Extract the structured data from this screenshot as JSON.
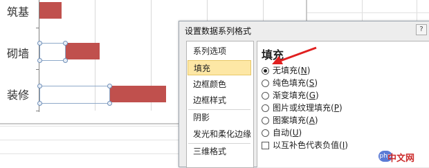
{
  "chart": {
    "categories": [
      "筑基",
      "砌墙",
      "装修"
    ]
  },
  "chart_data": {
    "type": "bar",
    "categories": [
      "筑基",
      "砌墙",
      "装修"
    ],
    "series": [
      {
        "values": [
          0,
          2,
          5
        ]
      },
      {
        "values": [
          2,
          2,
          4
        ]
      }
    ]
  },
  "dialog": {
    "title": "设置数据系列格式",
    "help": "?",
    "nav": [
      {
        "label": "系列选项",
        "active": false
      },
      {
        "label": "填充",
        "active": true
      },
      {
        "label": "边框颜色",
        "active": false
      },
      {
        "label": "边框样式",
        "active": false
      },
      {
        "label": "阴影",
        "active": false
      },
      {
        "label": "发光和柔化边缘",
        "active": false
      },
      {
        "label": "三维格式",
        "active": false
      }
    ],
    "section_title": "填充",
    "fill_options": [
      {
        "label": "无填充",
        "key": "N",
        "checked": true
      },
      {
        "label": "纯色填充",
        "key": "S",
        "checked": false
      },
      {
        "label": "渐变填充",
        "key": "G",
        "checked": false
      },
      {
        "label": "图片或纹理填充",
        "key": "P",
        "checked": false
      },
      {
        "label": "图案填充",
        "key": "A",
        "checked": false
      },
      {
        "label": "自动",
        "key": "U",
        "checked": false
      }
    ],
    "invert_option": {
      "label": "以互补色代表负值",
      "key": "I",
      "checked": false
    }
  },
  "colors": {
    "bar": "#c0504d",
    "nav_active": "#fde7a5",
    "arrow": "#e02020"
  },
  "watermark": {
    "logo": "php",
    "text": "中文网"
  }
}
